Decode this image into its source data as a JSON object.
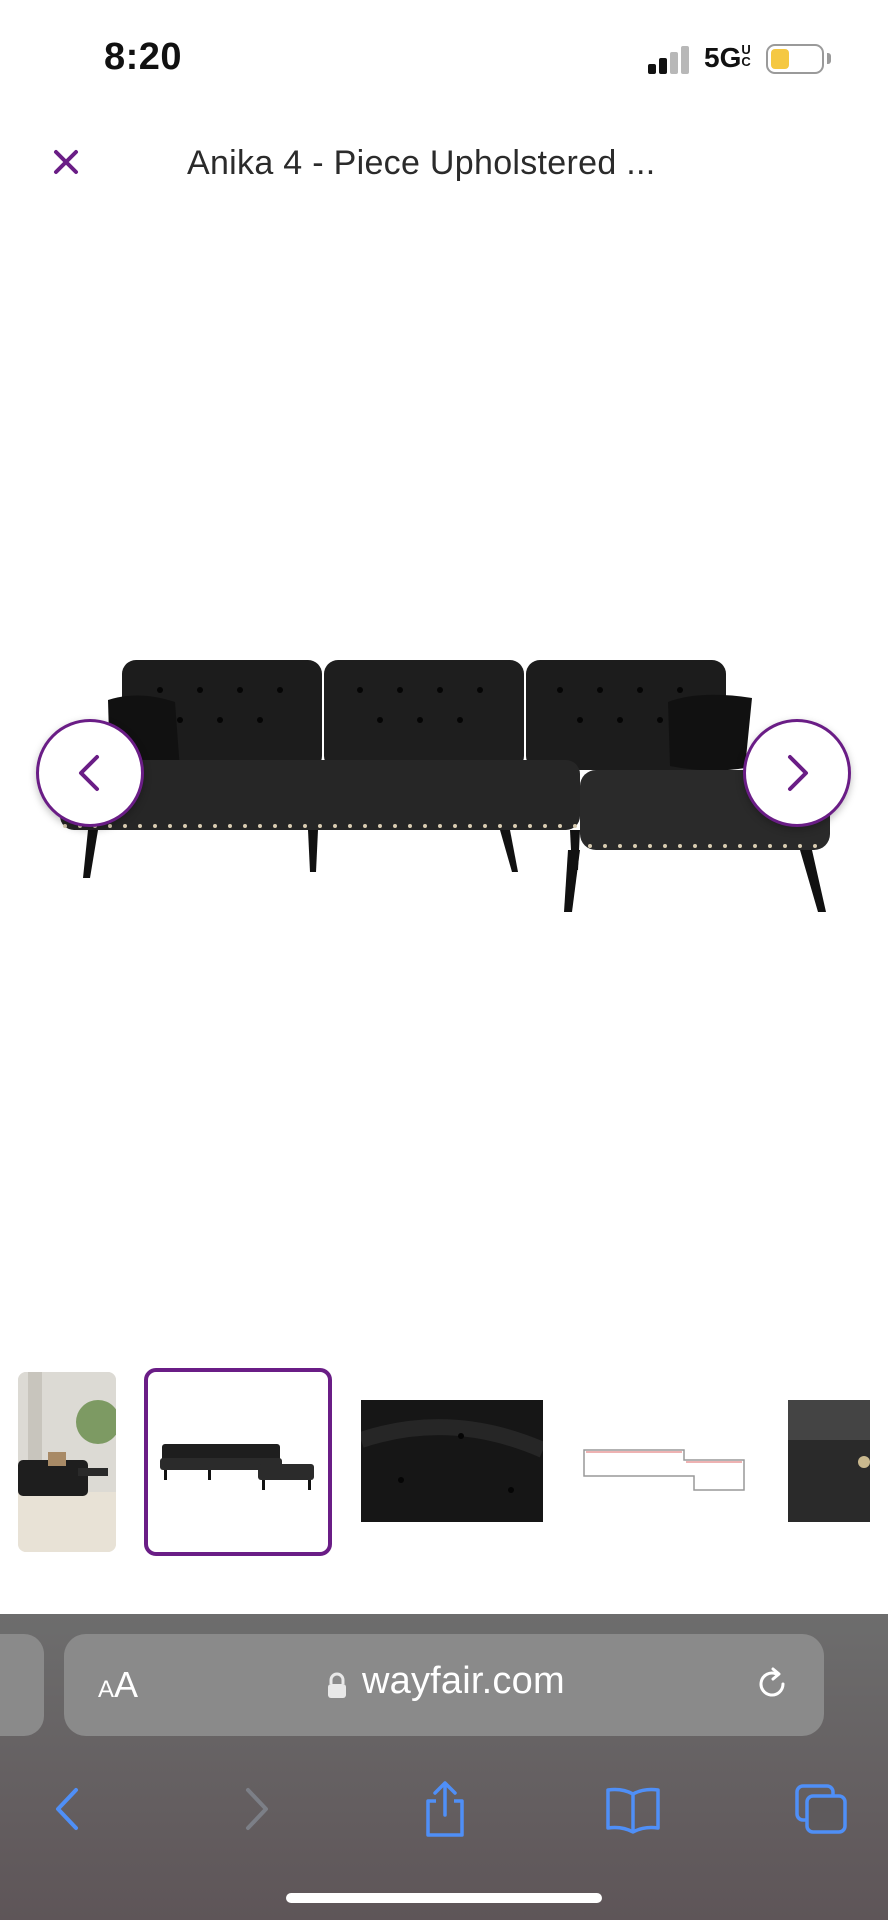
{
  "status_bar": {
    "time": "8:20",
    "network": "5G",
    "network_suffix": "UC",
    "battery_color": "#f5c842"
  },
  "header": {
    "title": "Anika 4 - Piece Upholstered ...",
    "close_icon": "close-icon",
    "accent_color": "#6a1d86"
  },
  "gallery": {
    "prev_icon": "chevron-left-icon",
    "next_icon": "chevron-right-icon",
    "selected_index": 1,
    "thumbnails": [
      {
        "name": "lifestyle-room"
      },
      {
        "name": "sectional-black-front"
      },
      {
        "name": "fabric-tufting-closeup"
      },
      {
        "name": "dimension-diagram"
      },
      {
        "name": "armrest-detail"
      }
    ]
  },
  "browser": {
    "text_size_label_small": "A",
    "text_size_label_large": "A",
    "url": "wayfair.com",
    "toolbar_icons": [
      "back-icon",
      "forward-icon",
      "share-icon",
      "bookmarks-icon",
      "tabs-icon"
    ],
    "toolbar_color": "#4f8ff7"
  }
}
